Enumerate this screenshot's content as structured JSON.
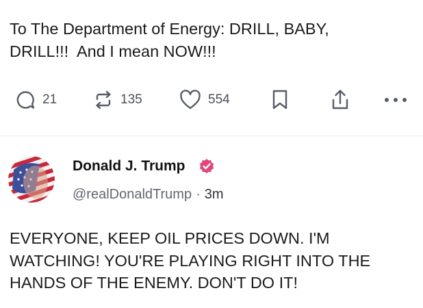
{
  "post1": {
    "text": "To The Department of Energy: DRILL, BABY,\nDRILL!!!  And I mean NOW!!!",
    "actions": {
      "replies": "21",
      "reposts": "135",
      "likes": "554"
    },
    "icons": [
      "reply-icon",
      "repost-icon",
      "like-icon",
      "bookmark-icon",
      "share-icon",
      "more-icon"
    ]
  },
  "post2": {
    "display_name": "Donald J. Trump",
    "handle": "@realDonaldTrump",
    "separator": "·",
    "time": "3m",
    "text": "EVERYONE, KEEP OIL PRICES DOWN. I'M\nWATCHING! YOU'RE PLAYING RIGHT INTO THE\nHANDS OF THE ENEMY. DON'T DO IT!"
  },
  "colors": {
    "icon": "#555b66",
    "verified_badge": "#e0457b",
    "divider": "#ebecee"
  }
}
